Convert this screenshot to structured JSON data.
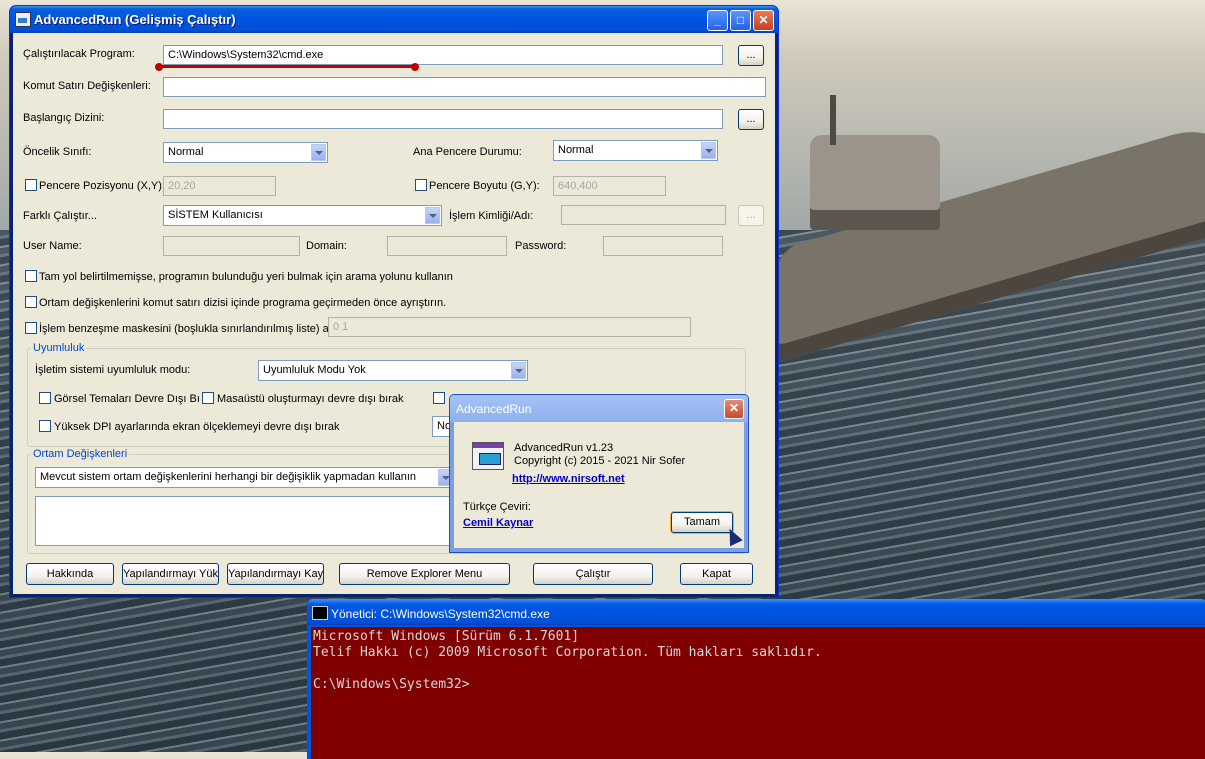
{
  "main": {
    "title": "AdvancedRun (Gelişmiş Çalıştır)",
    "program_label": "Çalıştırılacak Program:",
    "program_value": "C:\\Windows\\System32\\cmd.exe",
    "browse": "...",
    "cmdline_label": "Komut Satırı Değişkenleri:",
    "cmdline_value": "",
    "startdir_label": "Başlangıç Dizini:",
    "startdir_value": "",
    "priority_label": "Öncelik Sınıfı:",
    "priority_value": "Normal",
    "window_state_label": "Ana Pencere Durumu:",
    "window_state_value": "Normal",
    "window_pos_label": "Pencere Pozisyonu (X,Y):",
    "window_pos_value": "20,20",
    "window_size_label": "Pencere Boyutu (G,Y):",
    "window_size_value": "640,400",
    "runas_label": "Farklı Çalıştır...",
    "runas_value": "SİSTEM Kullanıcısı",
    "process_label": "İşlem Kimliği/Adı:",
    "username_label": "User Name:",
    "domain_label": "Domain:",
    "password_label": "Password:",
    "opt_search_path": "Tam yol belirtilmemişse, programın bulunduğu yeri bulmak için arama yolunu kullanın",
    "opt_parse_env": "Ortam değişkenlerini komut satırı dizisi içinde programa geçirmeden önce ayrıştırın.",
    "opt_affinity": "İşlem benzeşme maskesini (boşlukla sınırlandırılmış liste) aya",
    "affinity_value": "0 1",
    "compat_group": "Uyumluluk",
    "os_compat_label": "İşletim sistemi uyumluluk modu:",
    "os_compat_value": "Uyumluluk Modu Yok",
    "opt_visual_themes": "Görsel Temaları Devre Dışı Bıra",
    "opt_desktop_comp": "Masaüstü oluşturmayı devre dışı bırak",
    "opt_dpi": "Yüksek DPI ayarlarında ekran ölçeklemeyi devre dışı bırak",
    "dpi_select_partial": "No",
    "env_group": "Ortam Değişkenleri",
    "env_value": "Mevcut sistem ortam değişkenlerini herhangi bir değişiklik yapmadan kullanın",
    "btn_about": "Hakkında",
    "btn_load": "Yapılandırmayı Yükle",
    "btn_save": "Yapılandırmayı Kaydet",
    "btn_remove_menu": "Remove Explorer Menu",
    "btn_run": "Çalıştır",
    "btn_close": "Kapat"
  },
  "about": {
    "title": "AdvancedRun",
    "version": "AdvancedRun v1.23",
    "copyright": "Copyright (c) 2015 - 2021 Nir Sofer",
    "url": "http://www.nirsoft.net",
    "translation_label": "Türkçe Çeviri:",
    "translator": "Cemil Kaynar",
    "ok": "Tamam"
  },
  "cmd": {
    "title": "Yönetici: C:\\Windows\\System32\\cmd.exe",
    "line1": "Microsoft Windows [Sürüm 6.1.7601]",
    "line2": "Telif Hakkı (c) 2009 Microsoft Corporation. Tüm hakları saklıdır.",
    "line3": "",
    "line4": "C:\\Windows\\System32>"
  },
  "colors": {
    "annotation": "#c00000",
    "cmd_background": "#800000",
    "titlebar": "#0054e3"
  }
}
